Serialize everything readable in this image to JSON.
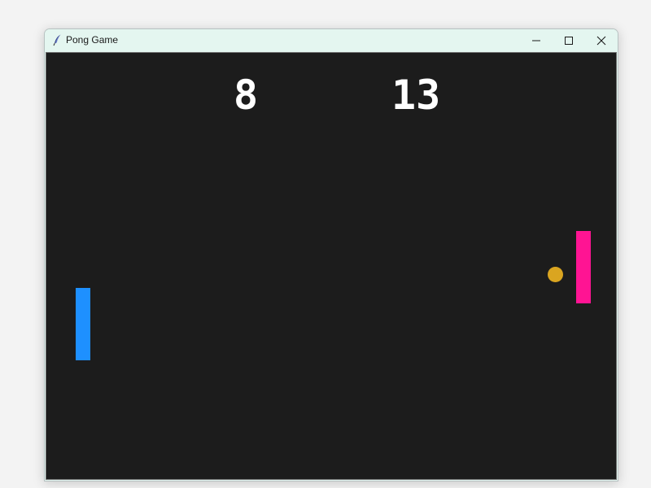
{
  "window": {
    "title": "Pong Game",
    "icon": "feather-icon"
  },
  "controls": {
    "minimize_icon": "minimize-icon",
    "maximize_icon": "maximize-icon",
    "close_icon": "close-icon"
  },
  "game": {
    "background_color": "#1c1c1c",
    "score_left": "8",
    "score_right": "13",
    "left_paddle_color": "#1e90ff",
    "right_paddle_color": "#ff1493",
    "ball_color": "#daa520"
  }
}
